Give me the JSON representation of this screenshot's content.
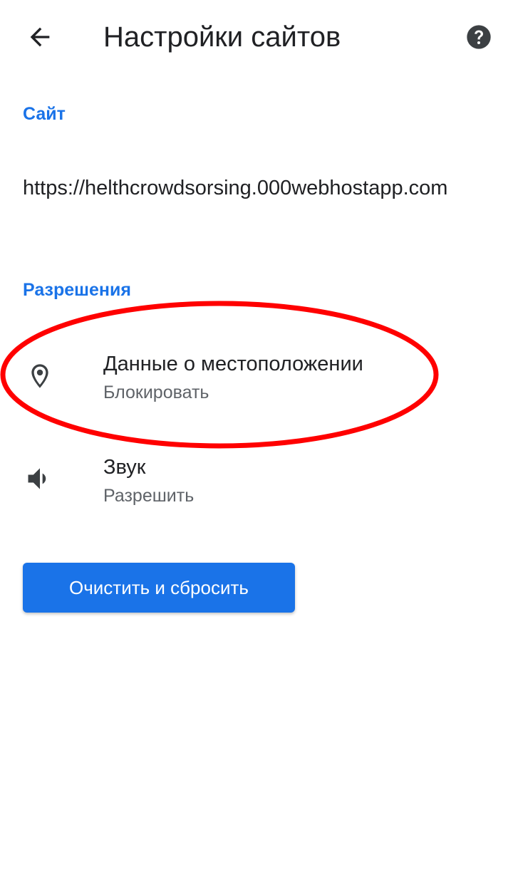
{
  "app_bar": {
    "title": "Настройки сайтов",
    "back_icon": "arrow-back-icon",
    "help_icon": "help-icon"
  },
  "site_section": {
    "header": "Сайт",
    "url": "https://helthcrowdsorsing.000webhostapp.com"
  },
  "permissions_section": {
    "header": "Разрешения",
    "items": [
      {
        "icon": "location-pin-icon",
        "title": "Данные о местоположении",
        "value": "Блокировать"
      },
      {
        "icon": "volume-icon",
        "title": "Звук",
        "value": "Разрешить"
      }
    ]
  },
  "reset_button": {
    "label": "Очистить и сбросить"
  },
  "colors": {
    "accent": "#1a73e8",
    "text_primary": "#202124",
    "text_secondary": "#5f6368",
    "annotation": "#ff0000"
  }
}
